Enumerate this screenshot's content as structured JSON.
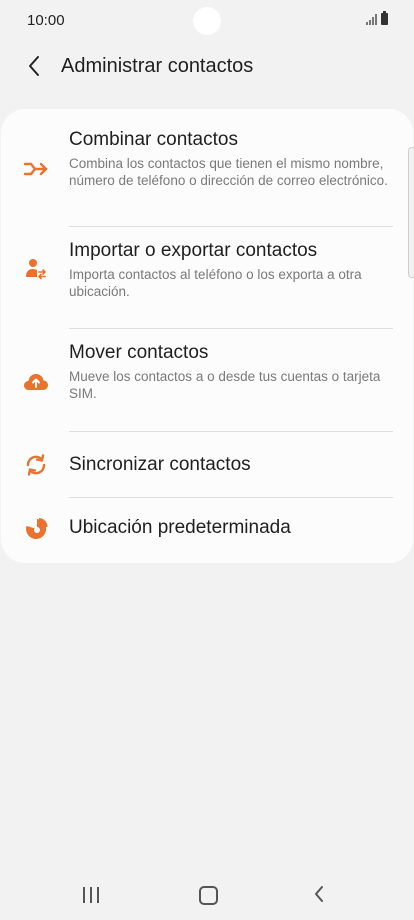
{
  "status_bar": {
    "time": "10:00"
  },
  "header": {
    "title": "Administrar contactos"
  },
  "menu": {
    "items": [
      {
        "title": "Combinar contactos",
        "description": "Combina los contactos que tienen el mismo nombre, número de teléfono o dirección de correo electrónico.",
        "icon": "merge-icon"
      },
      {
        "title": "Importar o exportar contactos",
        "description": "Importa contactos al teléfono o los exporta a otra ubicación.",
        "icon": "import-export-icon"
      },
      {
        "title": "Mover contactos",
        "description": "Mueve los contactos a o desde tus cuentas o tarjeta SIM.",
        "icon": "cloud-upload-icon"
      },
      {
        "title": "Sincronizar contactos",
        "icon": "sync-icon"
      },
      {
        "title": "Ubicación predeterminada",
        "icon": "pie-chart-icon"
      }
    ]
  },
  "colors": {
    "accent": "#e8722e",
    "background": "#f2f2f2",
    "card": "#fcfcfc"
  }
}
